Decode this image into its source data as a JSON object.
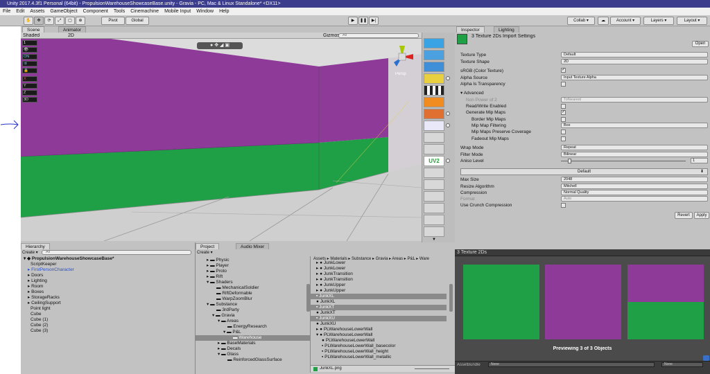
{
  "window": {
    "title": "Unity 2017.4.3f1 Personal (64bit) - PropulsionWarehouseShowcaseBase.unity - Gravia - PC, Mac & Linux Standalone* <DX11>"
  },
  "menu": [
    "File",
    "Edit",
    "Assets",
    "GameObject",
    "Component",
    "Tools",
    "Cinemachine",
    "Mobile Input",
    "Window",
    "Help"
  ],
  "toolbar": {
    "pivot": "Pivot",
    "global": "Global",
    "collab": "Collab",
    "account": "Account",
    "layers": "Layers",
    "layout": "Layout"
  },
  "scene": {
    "tab_scene": "Scene",
    "tab_animator": "Animator",
    "shaded": "Shaded",
    "mode_2d": "2D",
    "gizmos": "Gizmos",
    "search_placeholder": "All",
    "persp": "Persp",
    "side_buttons": [
      "1",
      "ON",
      "X",
      "Y",
      "Z",
      "3D"
    ],
    "uv2": "UV2"
  },
  "colors": {
    "wall_purple": "#8e3a98",
    "floor_green": "#1fa046",
    "accent_blue": "#3c3c8c"
  },
  "inspector": {
    "tab_inspector": "Inspector",
    "tab_lighting": "Lighting",
    "title": "3 Texture 2Ds Import Settings",
    "open": "Open",
    "texture_type_label": "Texture Type",
    "texture_type": "Default",
    "texture_shape_label": "Texture Shape",
    "texture_shape": "2D",
    "srgb_label": "sRGB (Color Texture)",
    "alpha_source_label": "Alpha Source",
    "alpha_source": "Input Texture Alpha",
    "alpha_transp_label": "Alpha Is Transparency",
    "advanced": "Advanced",
    "npot_label": "Non Power of 2",
    "npot": "ToNearest",
    "readwrite_label": "Read/Write Enabled",
    "mipmaps_label": "Generate Mip Maps",
    "border_label": "Border Mip Maps",
    "mipfilter_label": "Mip Map Filtering",
    "mipfilter": "Box",
    "mipcov_label": "Mip Maps Preserve Coverage",
    "fadeout_label": "Fadeout Mip Maps",
    "wrap_label": "Wrap Mode",
    "wrap": "Repeat",
    "filter_label": "Filter Mode",
    "filter": "Bilinear",
    "aniso_label": "Aniso Level",
    "aniso": "1",
    "platform": "Default",
    "maxsize_label": "Max Size",
    "maxsize": "2048",
    "resize_label": "Resize Algorithm",
    "resize": "Mitchell",
    "compression_label": "Compression",
    "compression": "Normal Quality",
    "format_label": "Format",
    "format": "Auto",
    "crunch_label": "Use Crunch Compression",
    "revert": "Revert",
    "apply": "Apply"
  },
  "hierarchy": {
    "tab": "Hierarchy",
    "create": "Create",
    "search_placeholder": "All",
    "scene": "PropulsionWarehouseShowcaseBase*",
    "items": [
      "ScriptKeeper",
      "FirstPersonCharacter",
      "Doors",
      "Lighting",
      "Room",
      "Boxes",
      "StorageRacks",
      "CeilingSupport",
      "Point light",
      "Cube",
      "Cube (1)",
      "Cube (2)",
      "Cube (3)"
    ]
  },
  "project": {
    "tab_project": "Project",
    "tab_mixer": "Audio Mixer",
    "create": "Create",
    "tree": [
      "Physic",
      "Player",
      "Proto",
      "Rift",
      "Shaders",
      "MechanicalSoldier",
      "RiftDeformable",
      "WarpZoomBlur",
      "Substance",
      "3rdParty",
      "Gravia",
      "Areas",
      "EnergyResearch",
      "P&L",
      "Warehouse",
      "BaseMaterials",
      "Decals",
      "Glass",
      "ReinforcedGlassSurface"
    ],
    "breadcrumb": "Assets ▸ Materials ▸ Substance ▸ Gravia ▸ Areas ▸ P&L ▸ Ware",
    "files": [
      "JunkLower",
      "JunkLower",
      "JunkTransition",
      "JunkTransition",
      "JunkUpper",
      "JunkUpper",
      "JunkXL",
      "JunkXL",
      "JunkXT",
      "JunkXT",
      "JunkXU",
      "JunkXU",
      "PLWarehouseLowerWall",
      "PLWarehouseLowerWall",
      "PLWarehouseLowerWall",
      "PLWarehouseLowerWall_basecolor",
      "PLWarehouseLowerWall_height",
      "PLWarehouseLowerWall_metallic"
    ],
    "selected_file": "JunkXL.png"
  },
  "preview": {
    "title": "3 Texture 2Ds",
    "caption": "Previewing 3 of 3 Objects",
    "assetbundle": "AssetBundle",
    "none1": "None",
    "none2": "None"
  }
}
